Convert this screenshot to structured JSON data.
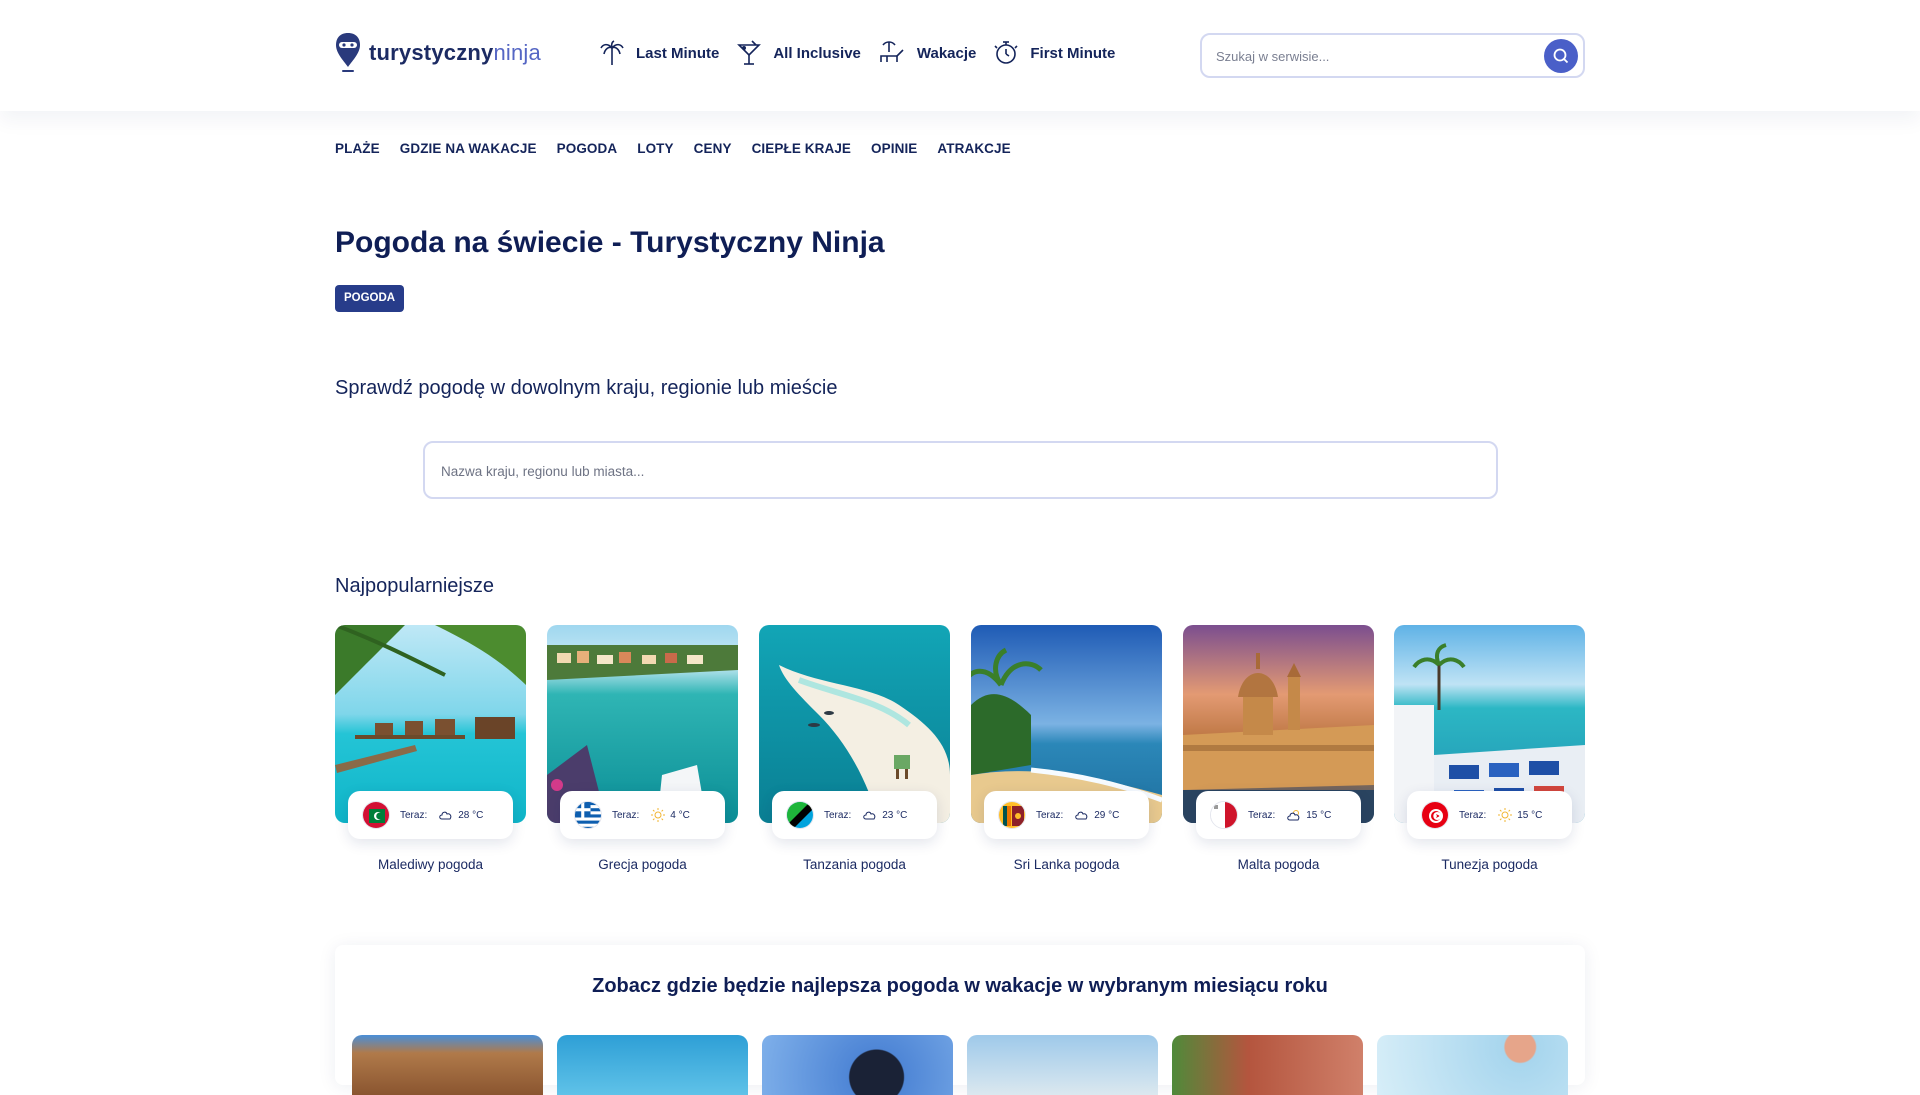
{
  "header": {
    "logo": {
      "main": "turystyczny",
      "accent": "ninja"
    },
    "nav": [
      {
        "label": "Last Minute",
        "icon": "palm-tree-icon"
      },
      {
        "label": "All Inclusive",
        "icon": "cocktail-icon"
      },
      {
        "label": "Wakacje",
        "icon": "sunbed-icon"
      },
      {
        "label": "First Minute",
        "icon": "stopwatch-icon"
      }
    ],
    "search": {
      "placeholder": "Szukaj w serwisie...",
      "icon": "search-icon"
    }
  },
  "subnav": [
    "PLAŻE",
    "GDZIE NA WAKACJE",
    "POGODA",
    "LOTY",
    "CENY",
    "CIEPŁE KRAJE",
    "OPINIE",
    "ATRAKCJE"
  ],
  "page": {
    "title": "Pogoda na świecie - Turystyczny Ninja",
    "tag": "POGODA",
    "subtitle": "Sprawdź pogodę w dowolnym kraju, regionie lub mieście",
    "search_placeholder": "Nazwa kraju, regionu lub miasta..."
  },
  "popular": {
    "heading": "Najpopularniejsze",
    "items": [
      {
        "caption": "Malediwy pogoda",
        "now_label": "Teraz:",
        "temp": "28 °C",
        "weather_icon": "cloud-icon",
        "flag": "maldives-flag-icon"
      },
      {
        "caption": "Grecja pogoda",
        "now_label": "Teraz:",
        "temp": "4 °C",
        "weather_icon": "sun-icon",
        "flag": "greece-flag-icon"
      },
      {
        "caption": "Tanzania pogoda",
        "now_label": "Teraz:",
        "temp": "23 °C",
        "weather_icon": "cloud-icon",
        "flag": "tanzania-flag-icon"
      },
      {
        "caption": "Sri Lanka pogoda",
        "now_label": "Teraz:",
        "temp": "29 °C",
        "weather_icon": "cloud-icon",
        "flag": "sri-lanka-flag-icon"
      },
      {
        "caption": "Malta pogoda",
        "now_label": "Teraz:",
        "temp": "15 °C",
        "weather_icon": "sun-cloud-icon",
        "flag": "malta-flag-icon"
      },
      {
        "caption": "Tunezja pogoda",
        "now_label": "Teraz:",
        "temp": "15 °C",
        "weather_icon": "sun-icon",
        "flag": "tunisia-flag-icon"
      }
    ]
  },
  "months": {
    "title": "Zobacz gdzie będzie najlepsza pogoda w wakacje w wybranym miesiącu roku"
  },
  "colors": {
    "navy": "#14245a",
    "accent": "#4a5fc8",
    "tag_bg": "#273c8a",
    "border": "#d3d8f1"
  }
}
